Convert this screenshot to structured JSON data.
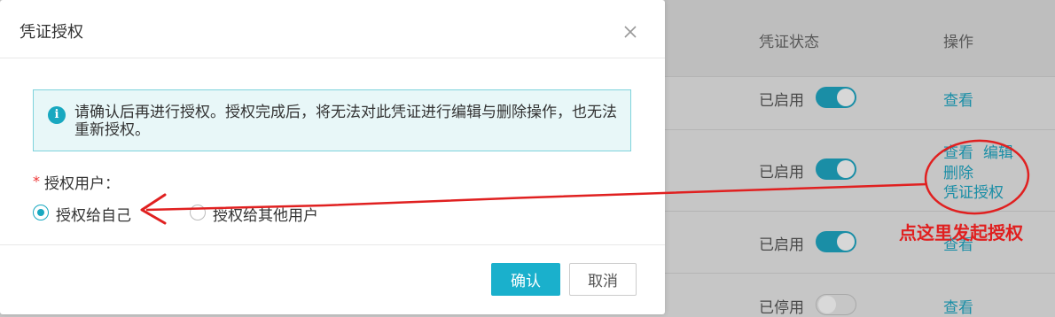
{
  "background_table": {
    "columns": {
      "status": "凭证状态",
      "operations": "操作"
    },
    "rows": [
      {
        "status": "已启用",
        "enabled": true,
        "ops": [
          "查看"
        ]
      },
      {
        "status": "已启用",
        "enabled": true,
        "ops": [
          "查看",
          "编辑",
          "删除",
          "凭证授权"
        ]
      },
      {
        "status": "已启用",
        "enabled": true,
        "ops": [
          "查看"
        ]
      },
      {
        "status": "已停用",
        "enabled": false,
        "ops": [
          "查看"
        ]
      }
    ]
  },
  "modal": {
    "title": "凭证授权",
    "alert_text": "请确认后再进行授权。授权完成后，将无法对此凭证进行编辑与删除操作，也无法重新授权。",
    "required_mark": "*",
    "field_label": "授权用户：",
    "options": [
      {
        "label": "授权给自己",
        "selected": true
      },
      {
        "label": "授权给其他用户",
        "selected": false
      }
    ],
    "confirm_label": "确认",
    "cancel_label": "取消"
  },
  "annotation": {
    "text": "点这里发起授权",
    "color": "#e02020"
  },
  "colors": {
    "accent": "#1ab0cc",
    "link": "#1a8ea6",
    "annotation": "#e02020"
  },
  "icons": {
    "close": "close-icon",
    "info": "info-icon"
  }
}
